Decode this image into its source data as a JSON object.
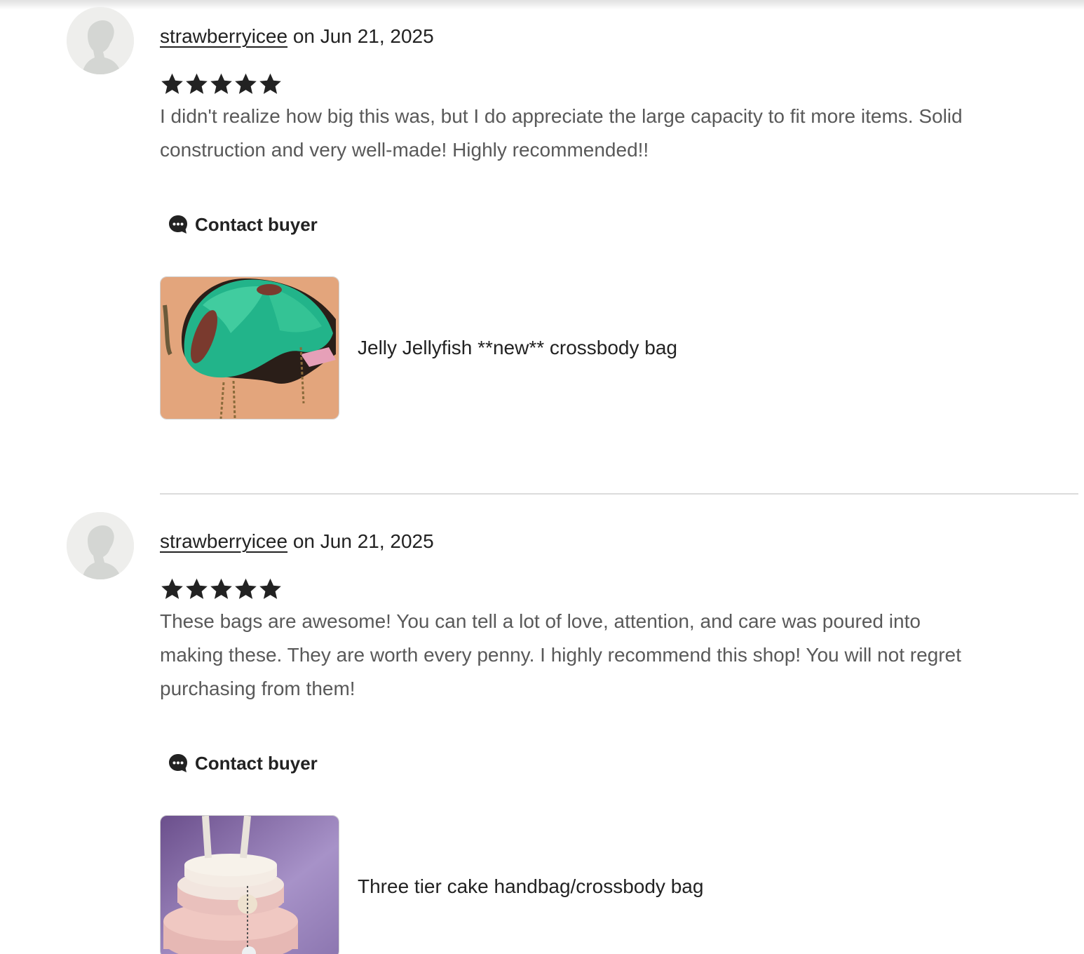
{
  "reviews": [
    {
      "username": "strawberryicee",
      "date_text": "on Jun 21, 2025",
      "rating": 5,
      "text": "I didn't realize how big this was, but I do appreciate the large capacity to fit more items. Solid construction and very well-made! Highly recommended!!",
      "contact_label": "Contact buyer",
      "listing_title": "Jelly Jellyfish **new** crossbody bag"
    },
    {
      "username": "strawberryicee",
      "date_text": "on Jun 21, 2025",
      "rating": 5,
      "text": "These bags are awesome! You can tell a lot of love, attention, and care was poured into making these. They are worth every penny. I highly recommend this shop! You will not regret purchasing from them!",
      "contact_label": "Contact buyer",
      "listing_title": "Three tier cake handbag/crossbody bag"
    }
  ],
  "colors": {
    "text_primary": "#222222",
    "text_secondary": "#595959",
    "divider": "#dcdcdc",
    "avatar_bg": "#eeeeec"
  },
  "icons": {
    "star": "star-icon",
    "chat": "chat-bubble-icon",
    "avatar": "default-avatar-silhouette"
  }
}
